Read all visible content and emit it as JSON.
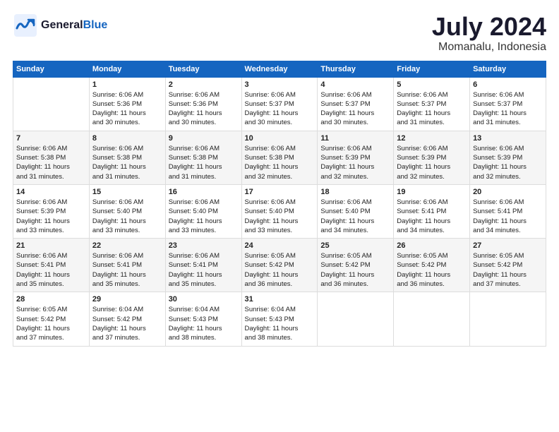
{
  "header": {
    "logo_general": "General",
    "logo_blue": "Blue",
    "title": "July 2024",
    "subtitle": "Momanalu, Indonesia"
  },
  "days_of_week": [
    "Sunday",
    "Monday",
    "Tuesday",
    "Wednesday",
    "Thursday",
    "Friday",
    "Saturday"
  ],
  "weeks": [
    [
      {
        "day": "",
        "content": ""
      },
      {
        "day": "1",
        "content": "Sunrise: 6:06 AM\nSunset: 5:36 PM\nDaylight: 11 hours\nand 30 minutes."
      },
      {
        "day": "2",
        "content": "Sunrise: 6:06 AM\nSunset: 5:36 PM\nDaylight: 11 hours\nand 30 minutes."
      },
      {
        "day": "3",
        "content": "Sunrise: 6:06 AM\nSunset: 5:37 PM\nDaylight: 11 hours\nand 30 minutes."
      },
      {
        "day": "4",
        "content": "Sunrise: 6:06 AM\nSunset: 5:37 PM\nDaylight: 11 hours\nand 30 minutes."
      },
      {
        "day": "5",
        "content": "Sunrise: 6:06 AM\nSunset: 5:37 PM\nDaylight: 11 hours\nand 31 minutes."
      },
      {
        "day": "6",
        "content": "Sunrise: 6:06 AM\nSunset: 5:37 PM\nDaylight: 11 hours\nand 31 minutes."
      }
    ],
    [
      {
        "day": "7",
        "content": "Sunrise: 6:06 AM\nSunset: 5:38 PM\nDaylight: 11 hours\nand 31 minutes."
      },
      {
        "day": "8",
        "content": "Sunrise: 6:06 AM\nSunset: 5:38 PM\nDaylight: 11 hours\nand 31 minutes."
      },
      {
        "day": "9",
        "content": "Sunrise: 6:06 AM\nSunset: 5:38 PM\nDaylight: 11 hours\nand 31 minutes."
      },
      {
        "day": "10",
        "content": "Sunrise: 6:06 AM\nSunset: 5:38 PM\nDaylight: 11 hours\nand 32 minutes."
      },
      {
        "day": "11",
        "content": "Sunrise: 6:06 AM\nSunset: 5:39 PM\nDaylight: 11 hours\nand 32 minutes."
      },
      {
        "day": "12",
        "content": "Sunrise: 6:06 AM\nSunset: 5:39 PM\nDaylight: 11 hours\nand 32 minutes."
      },
      {
        "day": "13",
        "content": "Sunrise: 6:06 AM\nSunset: 5:39 PM\nDaylight: 11 hours\nand 32 minutes."
      }
    ],
    [
      {
        "day": "14",
        "content": "Sunrise: 6:06 AM\nSunset: 5:39 PM\nDaylight: 11 hours\nand 33 minutes."
      },
      {
        "day": "15",
        "content": "Sunrise: 6:06 AM\nSunset: 5:40 PM\nDaylight: 11 hours\nand 33 minutes."
      },
      {
        "day": "16",
        "content": "Sunrise: 6:06 AM\nSunset: 5:40 PM\nDaylight: 11 hours\nand 33 minutes."
      },
      {
        "day": "17",
        "content": "Sunrise: 6:06 AM\nSunset: 5:40 PM\nDaylight: 11 hours\nand 33 minutes."
      },
      {
        "day": "18",
        "content": "Sunrise: 6:06 AM\nSunset: 5:40 PM\nDaylight: 11 hours\nand 34 minutes."
      },
      {
        "day": "19",
        "content": "Sunrise: 6:06 AM\nSunset: 5:41 PM\nDaylight: 11 hours\nand 34 minutes."
      },
      {
        "day": "20",
        "content": "Sunrise: 6:06 AM\nSunset: 5:41 PM\nDaylight: 11 hours\nand 34 minutes."
      }
    ],
    [
      {
        "day": "21",
        "content": "Sunrise: 6:06 AM\nSunset: 5:41 PM\nDaylight: 11 hours\nand 35 minutes."
      },
      {
        "day": "22",
        "content": "Sunrise: 6:06 AM\nSunset: 5:41 PM\nDaylight: 11 hours\nand 35 minutes."
      },
      {
        "day": "23",
        "content": "Sunrise: 6:06 AM\nSunset: 5:41 PM\nDaylight: 11 hours\nand 35 minutes."
      },
      {
        "day": "24",
        "content": "Sunrise: 6:05 AM\nSunset: 5:42 PM\nDaylight: 11 hours\nand 36 minutes."
      },
      {
        "day": "25",
        "content": "Sunrise: 6:05 AM\nSunset: 5:42 PM\nDaylight: 11 hours\nand 36 minutes."
      },
      {
        "day": "26",
        "content": "Sunrise: 6:05 AM\nSunset: 5:42 PM\nDaylight: 11 hours\nand 36 minutes."
      },
      {
        "day": "27",
        "content": "Sunrise: 6:05 AM\nSunset: 5:42 PM\nDaylight: 11 hours\nand 37 minutes."
      }
    ],
    [
      {
        "day": "28",
        "content": "Sunrise: 6:05 AM\nSunset: 5:42 PM\nDaylight: 11 hours\nand 37 minutes."
      },
      {
        "day": "29",
        "content": "Sunrise: 6:04 AM\nSunset: 5:42 PM\nDaylight: 11 hours\nand 37 minutes."
      },
      {
        "day": "30",
        "content": "Sunrise: 6:04 AM\nSunset: 5:43 PM\nDaylight: 11 hours\nand 38 minutes."
      },
      {
        "day": "31",
        "content": "Sunrise: 6:04 AM\nSunset: 5:43 PM\nDaylight: 11 hours\nand 38 minutes."
      },
      {
        "day": "",
        "content": ""
      },
      {
        "day": "",
        "content": ""
      },
      {
        "day": "",
        "content": ""
      }
    ]
  ]
}
